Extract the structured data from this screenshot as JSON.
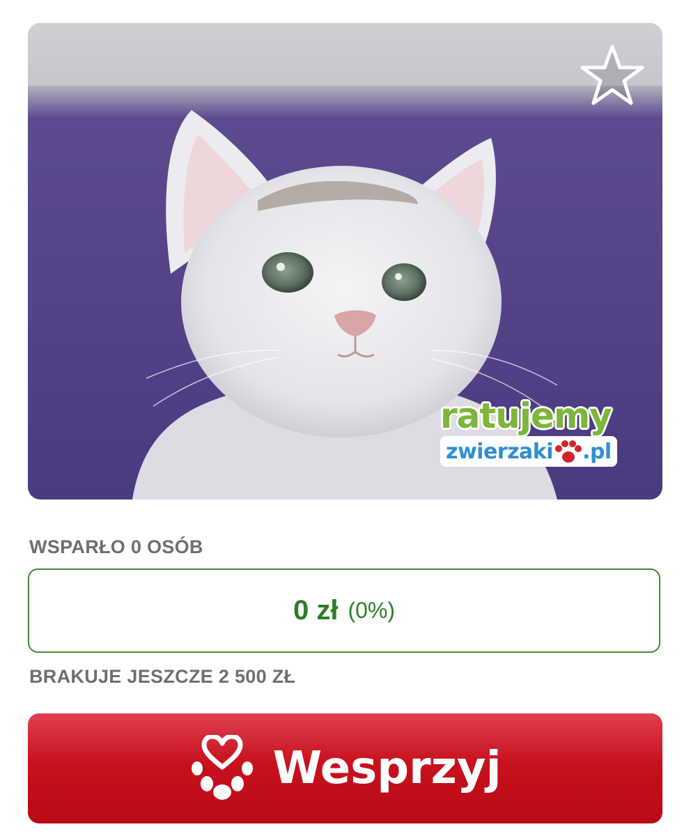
{
  "campaign": {
    "supporters_text": "WSPARŁO 0 OSÓB",
    "amount": "0 zł",
    "percent": "(0%)",
    "progress_fraction": 0,
    "missing_text": "BRAKUJE JESZCZE 2 500 ZŁ"
  },
  "logo": {
    "line1": "ratujemy",
    "line2": "zwierzaki",
    "suffix": ".pl"
  },
  "actions": {
    "support_label": "Wesprzyj"
  },
  "icons": {
    "favorite": "star-outline-icon",
    "support": "heart-paw-icon"
  },
  "colors": {
    "accent_green": "#2e7d25",
    "button_red": "#c8111d",
    "logo_green": "#7cb63a",
    "logo_blue": "#2f8fd1"
  }
}
